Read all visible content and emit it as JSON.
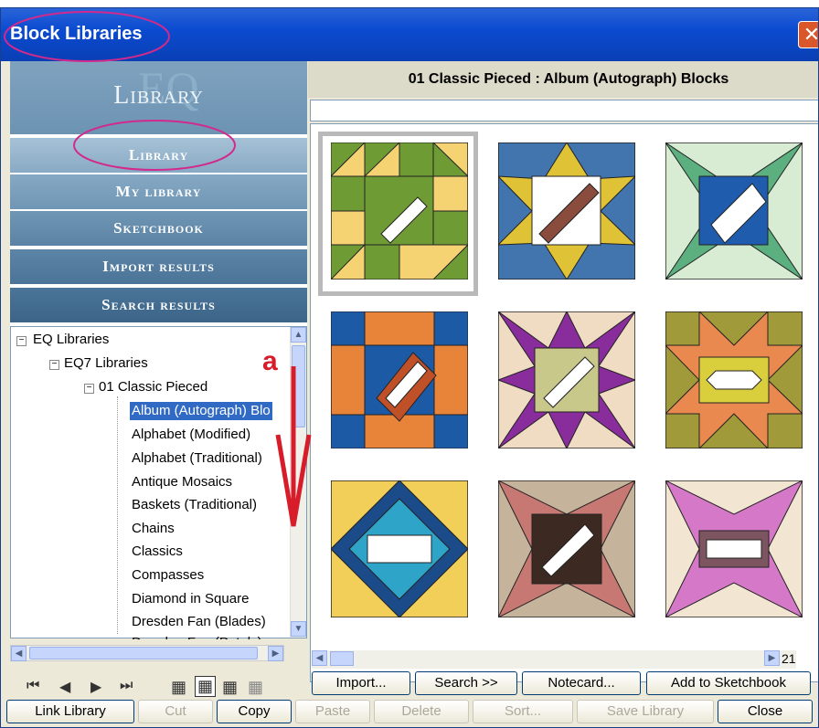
{
  "window": {
    "title": "Block Libraries",
    "close_glyph": "✕"
  },
  "sidebar": {
    "header_title": "Library",
    "header_watermark": "EQ",
    "nav": [
      "Library",
      "My library",
      "Sketchbook",
      "Import results",
      "Search results"
    ]
  },
  "tree": {
    "root": "EQ Libraries",
    "child": "EQ7 Libraries",
    "folder": "01 Classic Pieced",
    "items": [
      "Album (Autograph) Blo",
      "Alphabet (Modified)",
      "Alphabet (Traditional)",
      "Antique Mosaics",
      "Baskets (Traditional)",
      "Chains",
      "Classics",
      "Compasses",
      "Diamond in Square",
      "Dresden Fan (Blades)",
      "Dresden Fan (Petals)"
    ],
    "selected_index": 0
  },
  "main": {
    "heading": "01 Classic Pieced  :  Album (Autograph) Blocks",
    "page_count": "21"
  },
  "buttons_row1": {
    "import": "Import...",
    "search": "Search    >>",
    "notecard": "Notecard...",
    "add_sketchbook": "Add to Sketchbook"
  },
  "buttons_row2": {
    "link_library": "Link Library",
    "cut": "Cut",
    "copy": "Copy",
    "paste": "Paste",
    "delete": "Delete",
    "sort": "Sort...",
    "save_library": "Save Library",
    "close": "Close"
  },
  "annotation": {
    "label": "a",
    "color": "#d71c2a",
    "circle_color": "#d22a8c"
  }
}
